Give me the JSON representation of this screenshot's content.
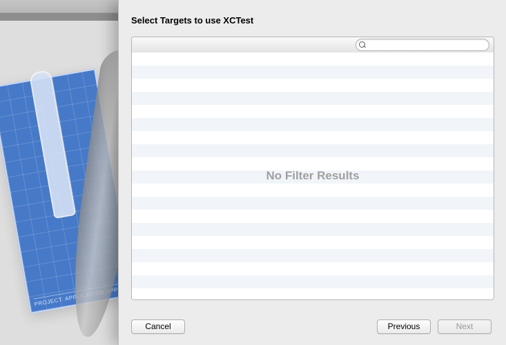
{
  "sheet": {
    "title": "Select Targets to use XCTest",
    "search_placeholder": "",
    "empty_message": "No Filter Results",
    "buttons": {
      "cancel": "Cancel",
      "previous": "Previous",
      "next": "Next"
    }
  },
  "backdrop": {
    "blueprint_label": "PROJECT: APPLICATION.APP"
  }
}
